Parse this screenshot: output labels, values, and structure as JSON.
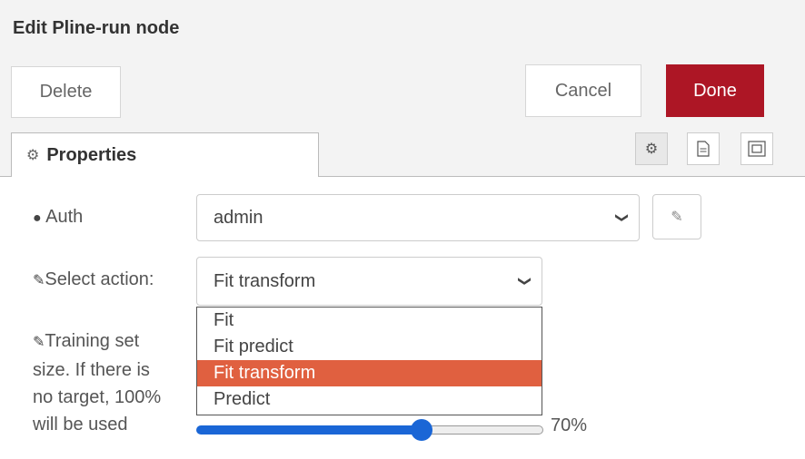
{
  "dialog": {
    "title": "Edit Pline-run node"
  },
  "toolbar": {
    "delete_label": "Delete",
    "cancel_label": "Cancel",
    "done_label": "Done"
  },
  "tabs": {
    "properties_label": "Properties",
    "active": "properties",
    "icons": [
      "gear-icon",
      "document-icon",
      "layout-icon"
    ]
  },
  "form": {
    "auth": {
      "label": "Auth",
      "icon": "globe-icon",
      "value": "admin"
    },
    "action": {
      "label": "Select action:",
      "icon": "pencil-icon",
      "value": "Fit transform",
      "options": [
        "Fit",
        "Fit predict",
        "Fit transform",
        "Predict"
      ],
      "selected_index": 2
    },
    "training": {
      "label_lines": [
        "Training set",
        "size. If there is",
        "no target, 100%",
        "will be used"
      ],
      "icon": "pencil-icon",
      "value_text": "70%",
      "value_fraction": 0.7
    }
  },
  "colors": {
    "done_button": "#ad1625",
    "selected_option": "#e06040",
    "slider": "#1a66d6"
  }
}
